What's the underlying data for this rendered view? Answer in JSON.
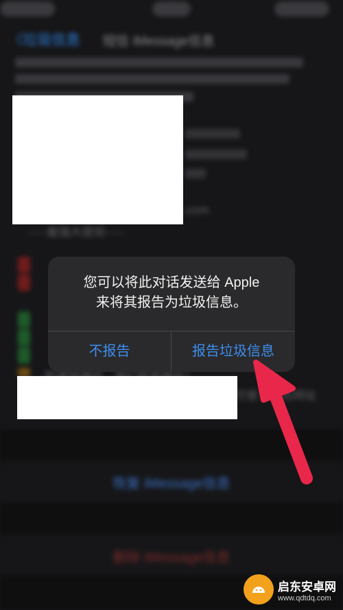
{
  "navbar": {
    "back_label": "〈垃圾信息",
    "title": "短信 iMessage信息"
  },
  "messages": {
    "fragment_url": ".com",
    "fragment_divider": "-----最强大提现-----",
    "fragment_bottom_left": "…知道找捷径…我们就是微信！",
    "fragment_bottom_right": "可使…点击网址"
  },
  "alert": {
    "message_line1": "您可以将此对话发送给 Apple",
    "message_line2": "来将其报告为垃圾信息。",
    "cancel_label": "不报告",
    "report_label": "报告垃圾信息"
  },
  "sheet": {
    "restore_label": "恢复 iMessage信息",
    "delete_label": "删除 iMessage信息"
  },
  "watermark": {
    "brand": "启东安卓网",
    "url": "www.qdtdq.com"
  },
  "colors": {
    "system_blue": "#3d8ef0",
    "alert_bg": "#2a2a2c",
    "arrow_red": "#e8274a",
    "watermark_orange": "#f3a11c"
  }
}
